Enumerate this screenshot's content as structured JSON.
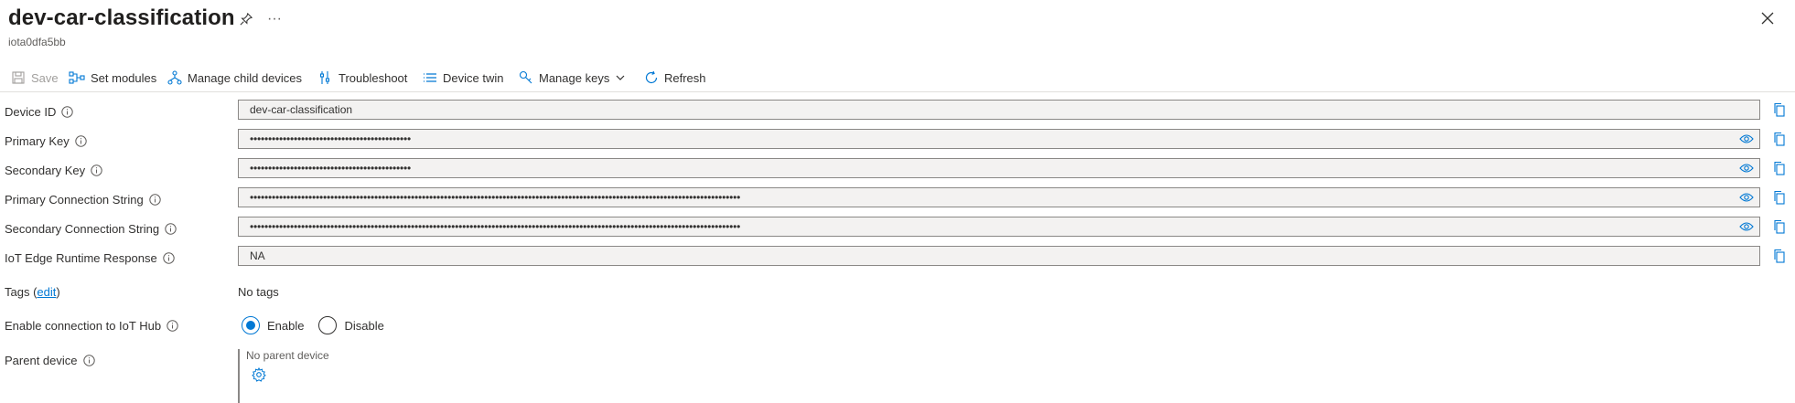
{
  "header": {
    "title": "dev-car-classification",
    "subtitle": "iota0dfa5bb",
    "more_label": "···",
    "icons": {
      "pin": "pin-icon",
      "close": "close-icon"
    }
  },
  "toolbar": {
    "save": "Save",
    "set_modules": "Set modules",
    "manage_child_devices": "Manage child devices",
    "troubleshoot": "Troubleshoot",
    "device_twin": "Device twin",
    "manage_keys": "Manage keys",
    "refresh": "Refresh"
  },
  "fields": {
    "device_id": {
      "label": "Device ID",
      "value": "dev-car-classification"
    },
    "primary_key": {
      "label": "Primary Key",
      "value": "••••••••••••••••••••••••••••••••••••••••••••"
    },
    "secondary_key": {
      "label": "Secondary Key",
      "value": "••••••••••••••••••••••••••••••••••••••••••••"
    },
    "primary_conn": {
      "label": "Primary Connection String",
      "value": "••••••••••••••••••••••••••••••••••••••••••••••••••••••••••••••••••••••••••••••••••••••••••••••••••••••••••••••••••••••••••••••••••••••"
    },
    "secondary_conn": {
      "label": "Secondary Connection String",
      "value": "••••••••••••••••••••••••••••••••••••••••••••••••••••••••••••••••••••••••••••••••••••••••••••••••••••••••••••••••••••••••••••••••••••••"
    },
    "runtime_response": {
      "label": "IoT Edge Runtime Response",
      "value": "NA"
    }
  },
  "tags": {
    "label_prefix": "Tags (",
    "edit_link": "edit",
    "label_suffix": ")",
    "value": "No tags"
  },
  "connection": {
    "label": "Enable connection to IoT Hub",
    "enable": "Enable",
    "disable": "Disable",
    "selected": "Enable"
  },
  "parent": {
    "label": "Parent device",
    "value": "No parent device"
  },
  "colors": {
    "accent": "#0078d4",
    "field_bg": "#f3f2f1",
    "border": "#8a8886",
    "text": "#323130"
  }
}
